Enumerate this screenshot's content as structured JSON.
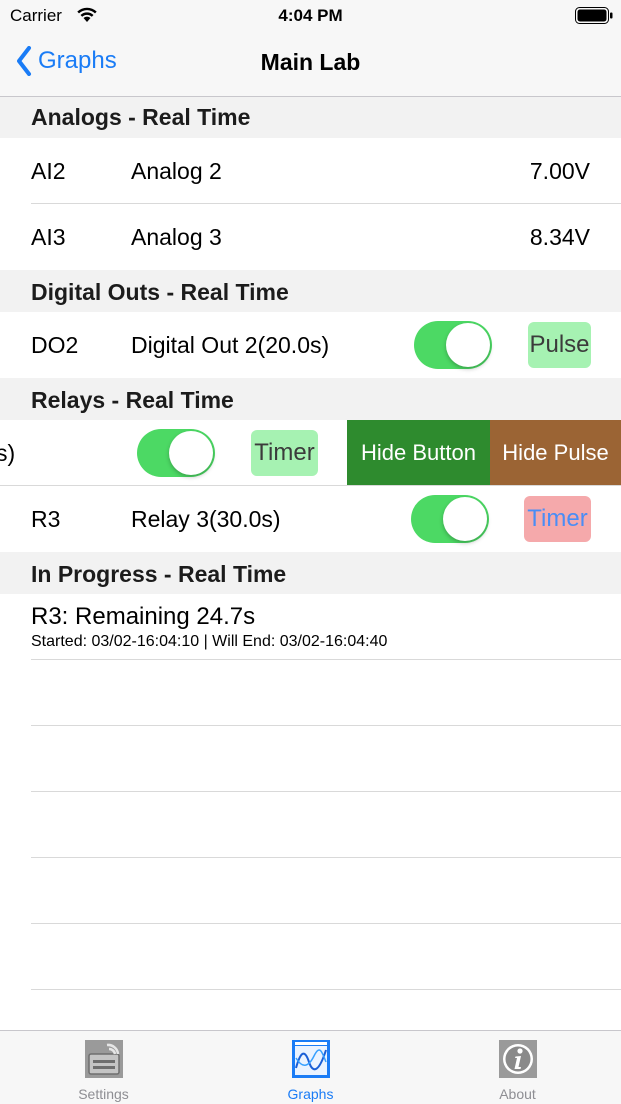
{
  "status_bar": {
    "carrier": "Carrier",
    "time": "4:04 PM"
  },
  "nav": {
    "back_label": "Graphs",
    "title": "Main Lab"
  },
  "analogs": {
    "header": "Analogs - Real Time",
    "rows": [
      {
        "code": "AI2",
        "name": "Analog 2",
        "value": "7.00V"
      },
      {
        "code": "AI3",
        "name": "Analog 3",
        "value": "8.34V"
      }
    ]
  },
  "digital_outs": {
    "header": "Digital Outs - Real Time",
    "rows": [
      {
        "code": "DO2",
        "name": "Digital Out 2(20.0s)",
        "toggle_on": true,
        "button": "Pulse"
      }
    ]
  },
  "relays": {
    "header": "Relays - Real Time",
    "swiped_row": {
      "name_tail": "s)",
      "toggle_on": true,
      "button": "Timer",
      "hide_button": "Hide Button",
      "hide_pulse": "Hide Pulse"
    },
    "rows": [
      {
        "code": "R3",
        "name": "Relay 3(30.0s)",
        "toggle_on": true,
        "button": "Timer"
      }
    ]
  },
  "in_progress": {
    "header": "In Progress - Real Time",
    "items": [
      {
        "main": "R3: Remaining 24.7s",
        "sub": "Started: 03/02-16:04:10 | Will End: 03/02-16:04:40"
      }
    ]
  },
  "tabs": [
    {
      "label": "Settings",
      "icon": "settings-icon",
      "active": false
    },
    {
      "label": "Graphs",
      "icon": "graphs-icon",
      "active": true
    },
    {
      "label": "About",
      "icon": "about-icon",
      "active": false
    }
  ],
  "colors": {
    "accent": "#1a7cf6",
    "toggle_on": "#4cd964",
    "pulse_button_bg": "#a6f2b2",
    "timer_active_bg": "#f5a9ab",
    "hide_button_bg": "#2e8b2e",
    "hide_pulse_bg": "#9b6434"
  }
}
